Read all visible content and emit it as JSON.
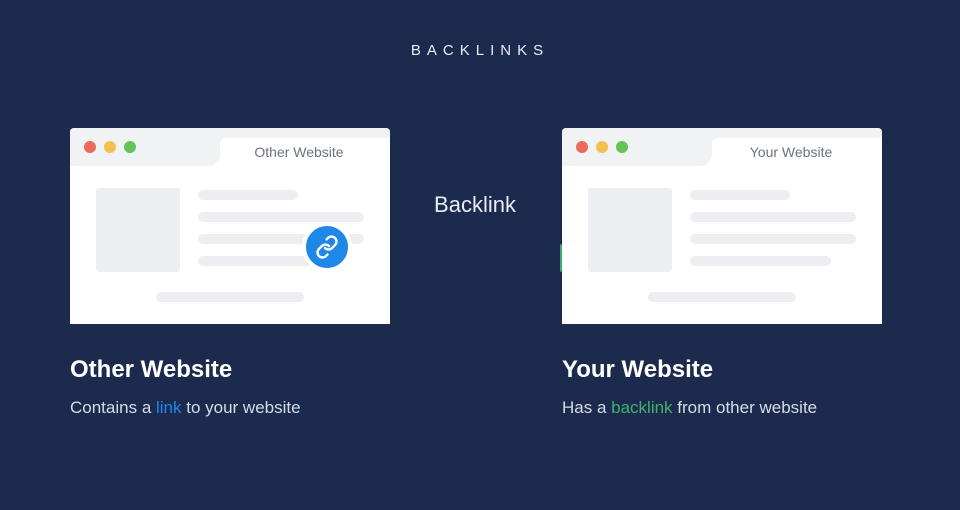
{
  "title": "BACKLINKS",
  "arrow_label": "Backlink",
  "left_panel": {
    "tab": "Other Website",
    "heading": "Other Website",
    "desc_prefix": "Contains a ",
    "desc_highlight": "link",
    "desc_suffix": " to your website"
  },
  "right_panel": {
    "tab": "Your Website",
    "heading": "Your Website",
    "desc_prefix": "Has a ",
    "desc_highlight": "backlink",
    "desc_suffix": " from other website"
  },
  "colors": {
    "background": "#1c2a4d",
    "link_badge": "#1f87e8",
    "highlight_link": "#1f87e8",
    "highlight_backlink": "#3fb36a"
  }
}
